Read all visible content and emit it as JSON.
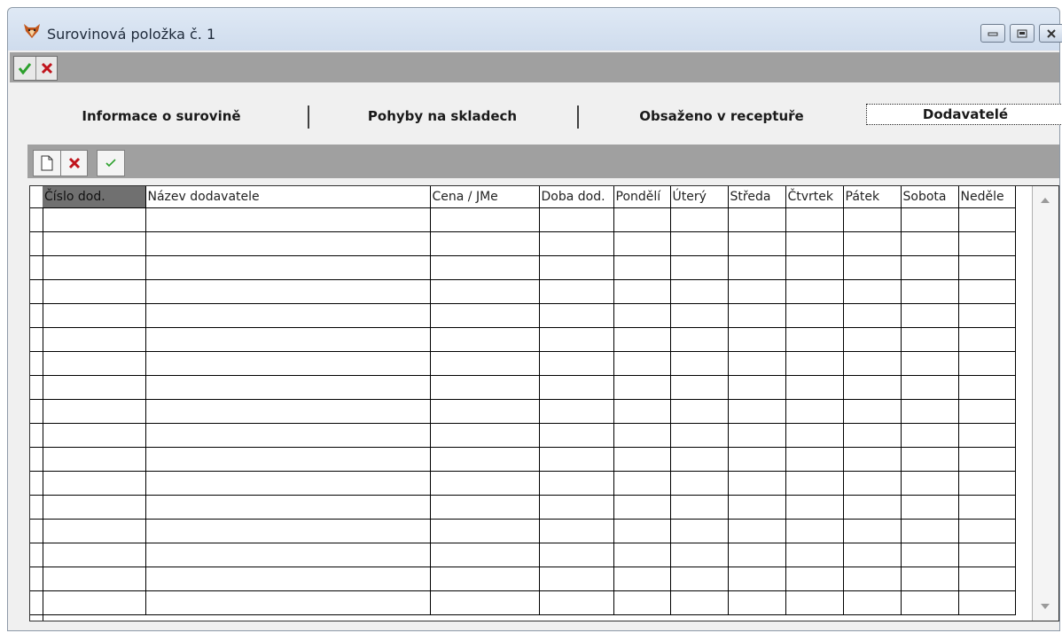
{
  "window": {
    "title": "Surovinová položka č. 1",
    "icon": "fox-app-icon",
    "controls": [
      "minimize-icon",
      "restore-icon",
      "close-icon"
    ]
  },
  "main_toolbar": {
    "confirm": "confirm-check-icon",
    "cancel": "cancel-x-icon"
  },
  "tabs": [
    {
      "label": "Informace o surovině"
    },
    {
      "label": "Pohyby na skladech"
    },
    {
      "label": "Obsaženo v receptuře"
    },
    {
      "label": "Dodavatelé",
      "active": true
    }
  ],
  "sub_toolbar": {
    "new": "new-document-icon",
    "delete": "delete-x-icon",
    "save": "save-check-icon"
  },
  "grid": {
    "columns": [
      "Číslo dod.",
      "Název dodavatele",
      "Cena / JMe",
      "Doba dod.",
      "Pondělí",
      "Úterý",
      "Středa",
      "Čtvrtek",
      "Pátek",
      "Sobota",
      "Neděle"
    ],
    "row_count": 17
  },
  "colors": {
    "toolbar_bg": "#a0a0a0",
    "confirm": "#2ca02c",
    "cancel": "#c0141c"
  }
}
